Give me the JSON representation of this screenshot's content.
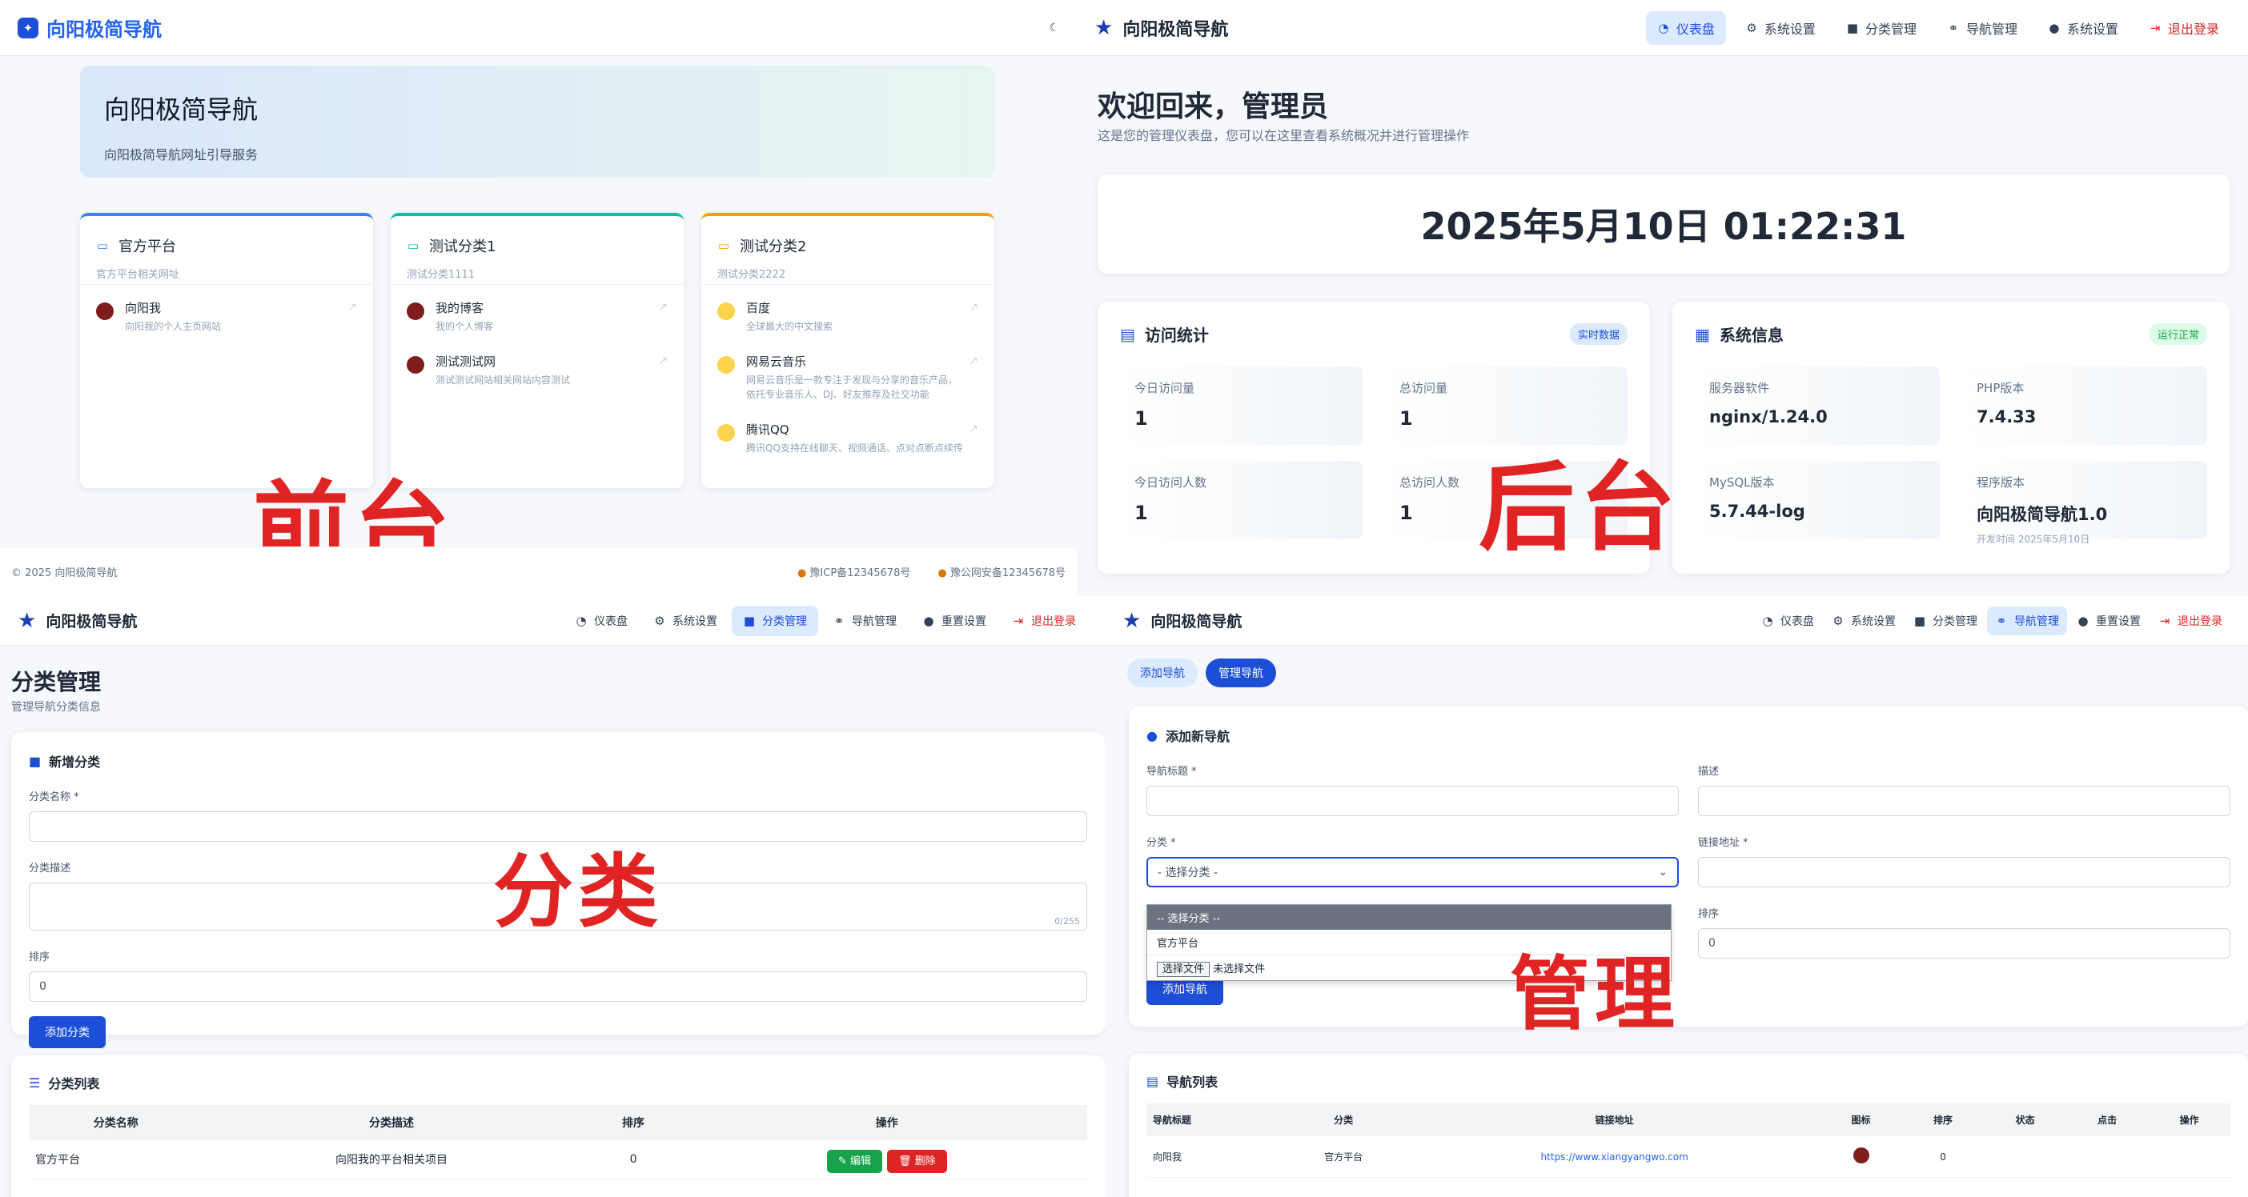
{
  "q1": {
    "brand": "向阳极简导航",
    "hero_title": "向阳极简导航",
    "hero_sub": "向阳极简导航网址引导服务",
    "categories": [
      {
        "title": "官方平台",
        "sub": "官方平台相关网址",
        "sites": [
          {
            "name": "向阳我",
            "desc": "向阳我的个人主页网站"
          }
        ]
      },
      {
        "title": "测试分类1",
        "sub": "测试分类1111",
        "sites": [
          {
            "name": "我的博客",
            "desc": "我的个人博客"
          },
          {
            "name": "测试测试网",
            "desc": "测试测试网站相关网站内容测试"
          }
        ]
      },
      {
        "title": "测试分类2",
        "sub": "测试分类2222",
        "sites": [
          {
            "name": "百度",
            "desc": "全球最大的中文搜索"
          },
          {
            "name": "网易云音乐",
            "desc": "网易云音乐是一款专注于发现与分享的音乐产品，依托专业音乐人、DJ、好友推荐及社交功能"
          },
          {
            "name": "腾讯QQ",
            "desc": "腾讯QQ支持在线聊天、视频通话、点对点断点续传"
          }
        ]
      }
    ],
    "footer_left": "© 2025 向阳极简导航",
    "footer_icp": "豫ICP备12345678号",
    "footer_police": "豫公网安备12345678号",
    "watermark": "前台"
  },
  "q2": {
    "brand": "向阳极简导航",
    "nav": [
      {
        "label": "仪表盘",
        "icon": "gauge-icon"
      },
      {
        "label": "系统设置",
        "icon": "gear-icon"
      },
      {
        "label": "分类管理",
        "icon": "folder-icon"
      },
      {
        "label": "导航管理",
        "icon": "link-icon"
      },
      {
        "label": "系统设置",
        "icon": "info-icon"
      },
      {
        "label": "退出登录",
        "icon": "logout-icon"
      }
    ],
    "welcome": "欢迎回来，管理员",
    "welcome_sub": "这是您的管理仪表盘，您可以在这里查看系统概况并进行管理操作",
    "clock": "2025年5月10日 01:22:31",
    "stats_title": "访问统计",
    "stats_badge": "实时数据",
    "stats": [
      {
        "label": "今日访问量",
        "value": "1"
      },
      {
        "label": "总访问量",
        "value": "1"
      },
      {
        "label": "今日访问人数",
        "value": "1"
      },
      {
        "label": "总访问人数",
        "value": "1"
      }
    ],
    "sys_title": "系统信息",
    "sys_badge": "运行正常",
    "sys": [
      {
        "label": "服务器软件",
        "value": "nginx/1.24.0",
        "extra": ""
      },
      {
        "label": "PHP版本",
        "value": "7.4.33",
        "extra": ""
      },
      {
        "label": "MySQL版本",
        "value": "5.7.44-log",
        "extra": ""
      },
      {
        "label": "程序版本",
        "value": "向阳极简导航1.0",
        "extra": "开发时间 2025年5月10日"
      }
    ],
    "watermark": "后台"
  },
  "q3": {
    "brand": "向阳极简导航",
    "nav": [
      {
        "label": "仪表盘",
        "icon": "gauge-icon"
      },
      {
        "label": "系统设置",
        "icon": "gear-icon"
      },
      {
        "label": "分类管理",
        "icon": "folder-icon"
      },
      {
        "label": "导航管理",
        "icon": "link-icon"
      },
      {
        "label": "重置设置",
        "icon": "info-icon"
      },
      {
        "label": "退出登录",
        "icon": "logout-icon"
      }
    ],
    "title": "分类管理",
    "sub": "管理导航分类信息",
    "form_title": "新增分类",
    "f_name": "分类名称 *",
    "f_desc": "分类描述",
    "f_desc_count": "0/255",
    "f_sort": "排序",
    "f_sort_value": "0",
    "submit": "添加分类",
    "list_title": "分类列表",
    "cols": [
      "分类名称",
      "分类描述",
      "排序",
      "操作"
    ],
    "rows": [
      {
        "name": "官方平台",
        "desc": "向阳我的平台相关项目",
        "sort": "0",
        "edit": "编辑",
        "del": "删除"
      }
    ],
    "watermark": "分类"
  },
  "q4": {
    "brand": "向阳极简导航",
    "nav": [
      {
        "label": "仪表盘",
        "icon": "gauge-icon"
      },
      {
        "label": "系统设置",
        "icon": "gear-icon"
      },
      {
        "label": "分类管理",
        "icon": "folder-icon"
      },
      {
        "label": "导航管理",
        "icon": "link-icon"
      },
      {
        "label": "重置设置",
        "icon": "info-icon"
      },
      {
        "label": "退出登录",
        "icon": "logout-icon"
      }
    ],
    "tabs": [
      "添加导航",
      "管理导航"
    ],
    "form_title": "添加新导航",
    "f_title": "导航标题 *",
    "f_desc": "描述",
    "f_cat": "分类 *",
    "f_cat_value": "- 选择分类 -",
    "f_url": "链接地址 *",
    "f_sort": "排序",
    "f_sort_value": "0",
    "dd_options": [
      "-- 选择分类 --",
      "官方平台"
    ],
    "file_btn": "选择文件",
    "file_text": "未选择文件",
    "submit": "添加导航",
    "list_title": "导航列表",
    "cols": [
      "导航标题",
      "分类",
      "链接地址",
      "图标",
      "排序",
      "状态",
      "点击",
      "操作"
    ],
    "rows": [
      {
        "title": "向阳我",
        "cat": "官方平台",
        "url": "https://www.xiangyangwo.com",
        "sort": "0"
      }
    ],
    "watermark": "管理"
  }
}
